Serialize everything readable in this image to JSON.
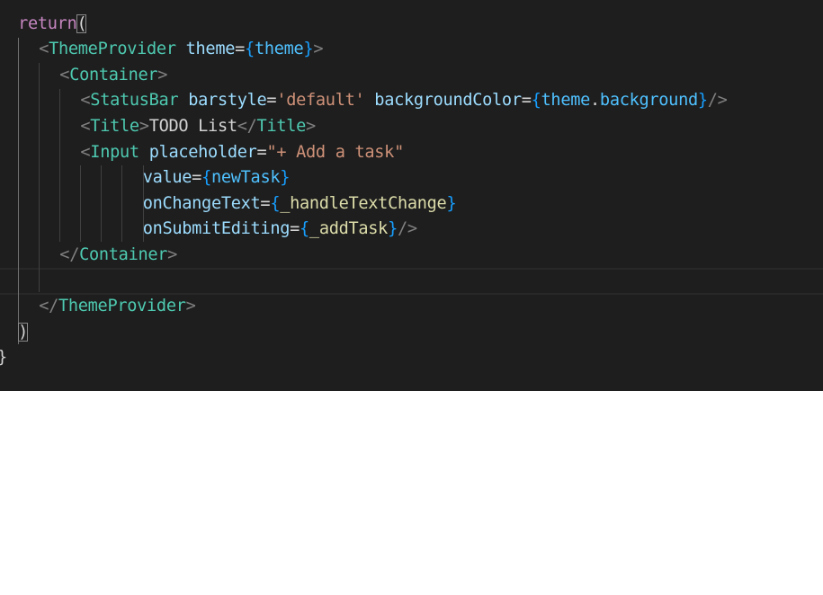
{
  "editor": {
    "colors": {
      "background": "#1e1e1e",
      "keyword": "#C586C0",
      "tag": "#4EC9B0",
      "attribute": "#9CDCFE",
      "string": "#CE9178",
      "bracket": "#179FFF",
      "function": "#DCDCAA"
    },
    "lines": [
      {
        "indent": 2,
        "tokens": [
          [
            "return",
            "kw"
          ],
          [
            "(",
            "par"
          ]
        ]
      },
      {
        "indent": 4,
        "tokens": [
          [
            "<",
            "pt"
          ],
          [
            "ThemeProvider",
            "tag"
          ],
          [
            " ",
            "txt"
          ],
          [
            "theme",
            "attr"
          ],
          [
            "=",
            "txt"
          ],
          [
            "{",
            "br"
          ],
          [
            "theme",
            "var"
          ],
          [
            "}",
            "br"
          ],
          [
            ">",
            "pt"
          ]
        ]
      },
      {
        "indent": 6,
        "tokens": [
          [
            "<",
            "pt"
          ],
          [
            "Container",
            "tag"
          ],
          [
            ">",
            "pt"
          ]
        ]
      },
      {
        "indent": 8,
        "tokens": [
          [
            "<",
            "pt"
          ],
          [
            "StatusBar",
            "tag"
          ],
          [
            " ",
            "txt"
          ],
          [
            "barstyle",
            "attr"
          ],
          [
            "=",
            "txt"
          ],
          [
            "'default'",
            "str"
          ],
          [
            " ",
            "txt"
          ],
          [
            "backgroundColor",
            "attr"
          ],
          [
            "=",
            "txt"
          ],
          [
            "{",
            "br"
          ],
          [
            "theme",
            "var"
          ],
          [
            ".",
            "txt"
          ],
          [
            "background",
            "var"
          ],
          [
            "}",
            "br"
          ],
          [
            "/>",
            "pt"
          ]
        ]
      },
      {
        "indent": 8,
        "tokens": [
          [
            "<",
            "pt"
          ],
          [
            "Title",
            "tag"
          ],
          [
            ">",
            "pt"
          ],
          [
            "TODO List",
            "txt"
          ],
          [
            "</",
            "pt"
          ],
          [
            "Title",
            "tag"
          ],
          [
            ">",
            "pt"
          ]
        ]
      },
      {
        "indent": 8,
        "tokens": [
          [
            "<",
            "pt"
          ],
          [
            "Input",
            "tag"
          ],
          [
            " ",
            "txt"
          ],
          [
            "placeholder",
            "attr"
          ],
          [
            "=",
            "txt"
          ],
          [
            "\"+ Add a task\"",
            "str"
          ]
        ]
      },
      {
        "indent": 14,
        "tokens": [
          [
            "value",
            "attr"
          ],
          [
            "=",
            "txt"
          ],
          [
            "{",
            "br"
          ],
          [
            "newTask",
            "var"
          ],
          [
            "}",
            "br"
          ]
        ]
      },
      {
        "indent": 14,
        "tokens": [
          [
            "onChangeText",
            "attr"
          ],
          [
            "=",
            "txt"
          ],
          [
            "{",
            "br"
          ],
          [
            "_handleTextChange",
            "fn"
          ],
          [
            "}",
            "br"
          ]
        ]
      },
      {
        "indent": 14,
        "tokens": [
          [
            "onSubmitEditing",
            "attr"
          ],
          [
            "=",
            "txt"
          ],
          [
            "{",
            "br"
          ],
          [
            "_addTask",
            "fn"
          ],
          [
            "}",
            "br"
          ],
          [
            "/>",
            "pt"
          ]
        ]
      },
      {
        "indent": 6,
        "tokens": [
          [
            "</",
            "pt"
          ],
          [
            "Container",
            "tag"
          ],
          [
            ">",
            "pt"
          ]
        ]
      },
      {
        "indent": 0,
        "tokens": []
      },
      {
        "indent": 4,
        "tokens": [
          [
            "</",
            "pt"
          ],
          [
            "ThemeProvider",
            "tag"
          ],
          [
            ">",
            "pt"
          ]
        ]
      },
      {
        "indent": 2,
        "tokens": [
          [
            ")",
            "par"
          ]
        ]
      },
      {
        "indent": 0,
        "tokens": [
          [
            "}",
            "brace"
          ]
        ]
      }
    ]
  }
}
